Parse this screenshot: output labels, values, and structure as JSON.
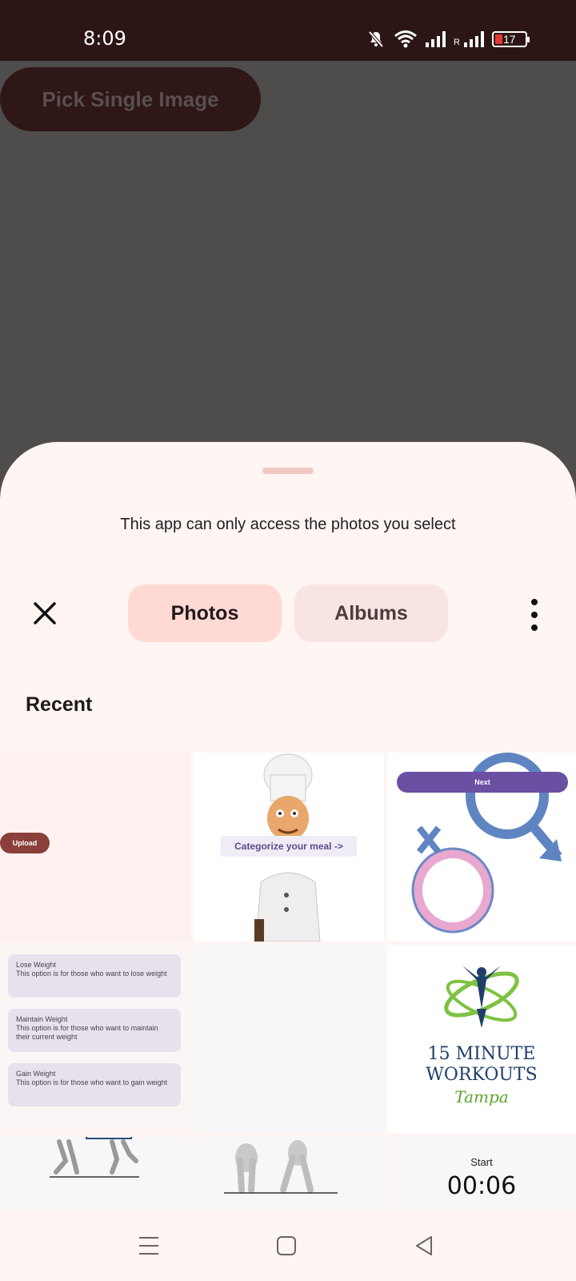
{
  "status_bar": {
    "time": "8:09",
    "roaming_label": "R",
    "battery_level": "17"
  },
  "app": {
    "pick_button_label": "Pick Single Image"
  },
  "picker": {
    "notice": "This app can only access the photos you select",
    "tabs": [
      {
        "label": "Photos",
        "selected": true
      },
      {
        "label": "Albums",
        "selected": false
      }
    ],
    "section_title": "Recent",
    "thumbnails": {
      "upload_label": "Upload",
      "meal_label": "Categorize your meal ->",
      "next_label": "Next",
      "goals": [
        {
          "title": "Lose Weight",
          "desc": "This option is for those who want to lose weight"
        },
        {
          "title": "Maintain Weight",
          "desc": "This option is for those who want to maintain their current weight"
        },
        {
          "title": "Gain Weight",
          "desc": "This option is for those who want to gain weight"
        }
      ],
      "workout_line1": "15 MINUTE",
      "workout_line2": "WORKOUTS",
      "workout_city": "Tampa",
      "timer_label": "Start",
      "timer_value": "00:06"
    }
  },
  "colors": {
    "status_bar": "#2c1615",
    "scrim": "#4f4c4c",
    "sheet": "#fff5f3",
    "tab_selected": "#ffdad5",
    "tab_unselected": "#f8e5e3"
  }
}
